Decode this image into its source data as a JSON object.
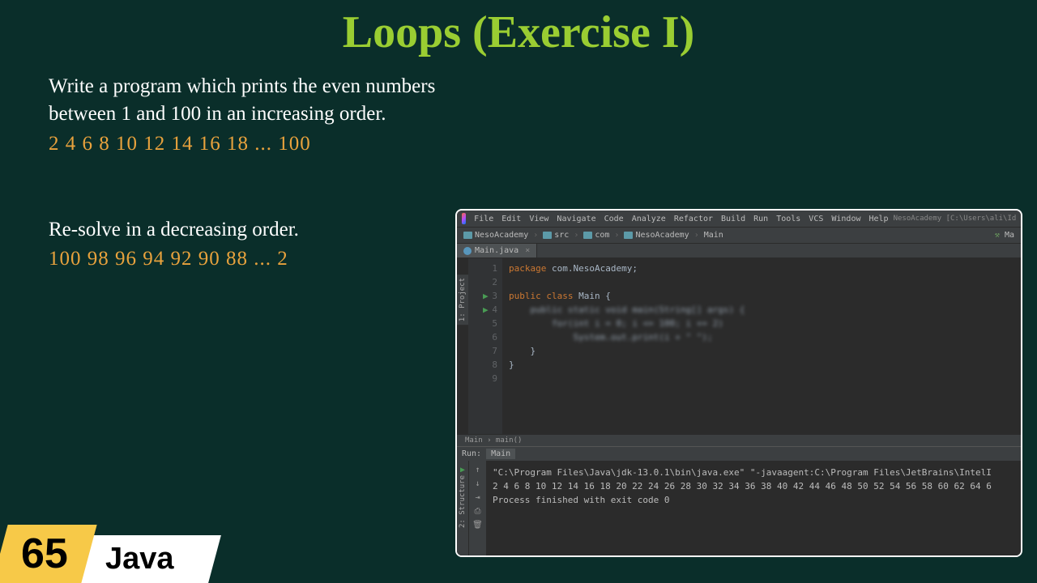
{
  "title": "Loops (Exercise I)",
  "problem1": {
    "line1": "Write a program which prints the even numbers",
    "line2": "between 1 and 100 in an increasing order.",
    "sequence": "2  4  6  8  10  12  14  16  18  ...  100"
  },
  "problem2": {
    "text": "Re-solve in a decreasing order.",
    "sequence": "100  98  96  94  92  90  88  ...  2"
  },
  "badge": {
    "number": "65",
    "label": "Java"
  },
  "ide": {
    "menu": [
      "File",
      "Edit",
      "View",
      "Navigate",
      "Code",
      "Analyze",
      "Refactor",
      "Build",
      "Run",
      "Tools",
      "VCS",
      "Window",
      "Help"
    ],
    "window_title": "NesoAcademy [C:\\Users\\ali\\IdeaProjects\\NesoAcademy] - ...\\src\\com\\NesoAca...",
    "breadcrumb": [
      "NesoAcademy",
      "src",
      "com",
      "NesoAcademy",
      "Main"
    ],
    "toolbar_right": "Ma",
    "tab": "Main.java",
    "side_tab_top": "1: Project",
    "side_tab_bottom": "2: Structure",
    "gutter": [
      "1",
      "2",
      "3",
      "4",
      "5",
      "6",
      "7",
      "8",
      "9"
    ],
    "code": {
      "l1_kw": "package ",
      "l1_rest": "com.NesoAcademy;",
      "l3_kw": "public class ",
      "l3_cls": "Main {",
      "l4_blur": "    public static void main(String[] args) {",
      "l5_blur": "        for(int i = 0; i <= 100; i += 2)",
      "l6_blur": "            System.out.print(i + \" \");",
      "l7": "    }",
      "l8": "}"
    },
    "crumb_footer": "Main › main()",
    "run": {
      "label": "Run:",
      "tab": "Main",
      "console_l1": "\"C:\\Program Files\\Java\\jdk-13.0.1\\bin\\java.exe\" \"-javaagent:C:\\Program Files\\JetBrains\\IntelI",
      "console_l2": "2 4 6 8 10 12 14 16 18 20 22 24 26 28 30 32 34 36 38 40 42 44 46 48 50 52 54 56 58 60 62 64 6",
      "console_l3": "Process finished with exit code 0"
    }
  }
}
